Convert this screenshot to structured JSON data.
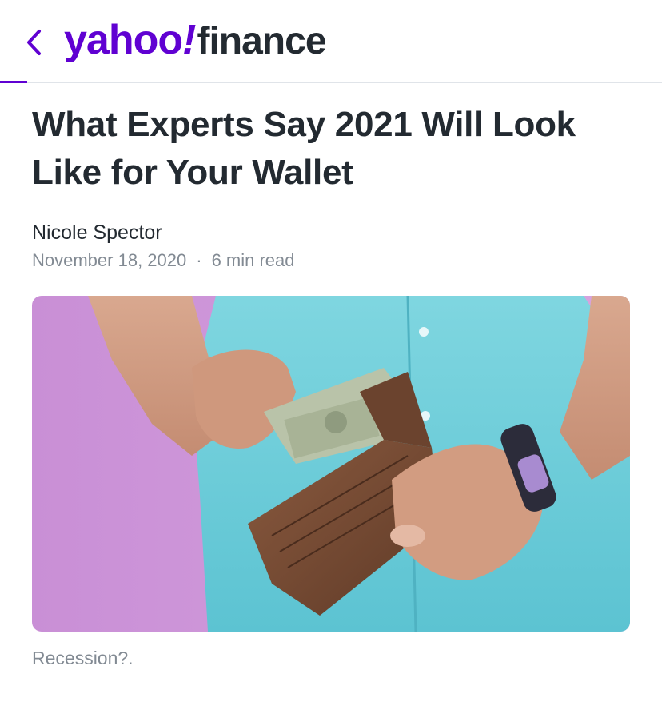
{
  "header": {
    "back_icon": "chevron-left-icon",
    "logo_brand": "yahoo",
    "logo_bang": "!",
    "logo_product": "finance",
    "accent_color": "#6001d2"
  },
  "article": {
    "title": "What Experts Say 2021 Will Look Like for Your Wallet",
    "author": "Nicole Spector",
    "date": "November 18, 2020",
    "separator": "·",
    "read_time": "6 min read",
    "image_caption": "Recession?."
  }
}
